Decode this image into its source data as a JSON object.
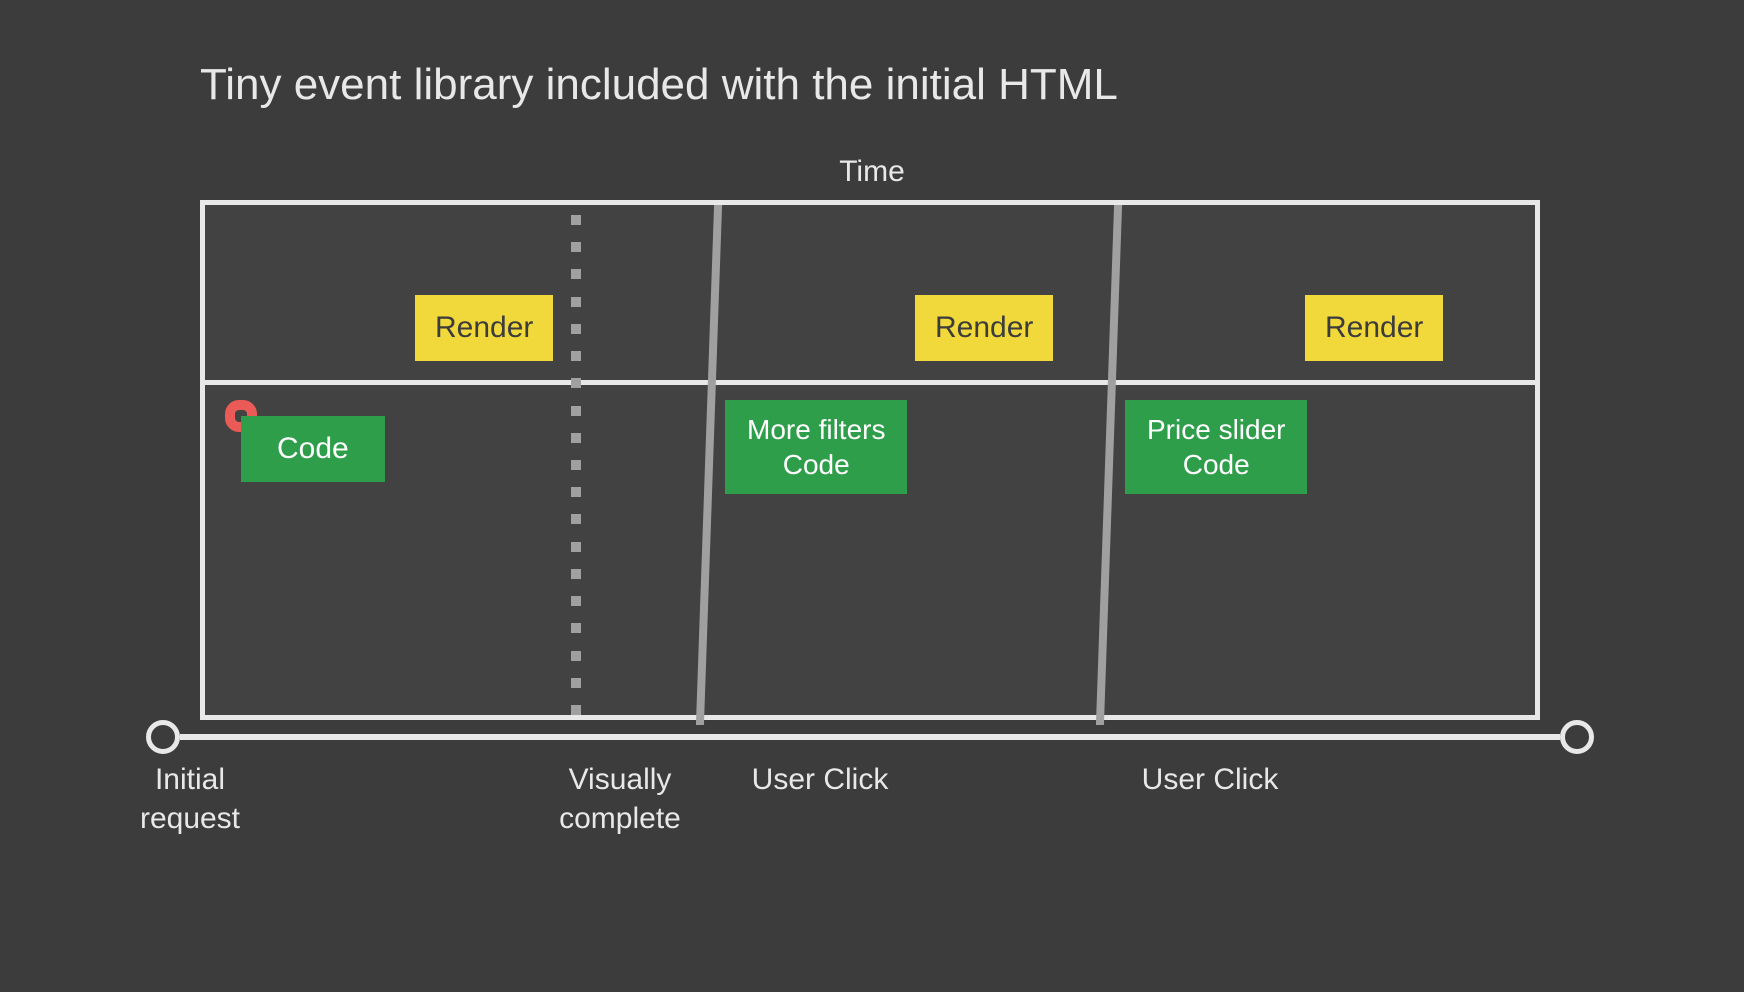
{
  "title": "Tiny event library included with the initial HTML",
  "time_label": "Time",
  "render": {
    "r1": "Render",
    "r2": "Render",
    "r3": "Render"
  },
  "code": {
    "c1": "Code",
    "c2_line1": "More filters",
    "c2_line2": "Code",
    "c3_line1": "Price slider",
    "c3_line2": "Code"
  },
  "labels": {
    "initial_line1": "Initial",
    "initial_line2": "request",
    "visual_line1": "Visually",
    "visual_line2": "complete",
    "click1": "User Click",
    "click2": "User Click"
  },
  "colors": {
    "background": "#3c3c3c",
    "panel": "#424242",
    "border": "#e8e8e8",
    "render_box": "#f2d93b",
    "code_box": "#2e9e4a",
    "highlight": "#ea5a56",
    "gray_line": "#a0a0a0"
  }
}
